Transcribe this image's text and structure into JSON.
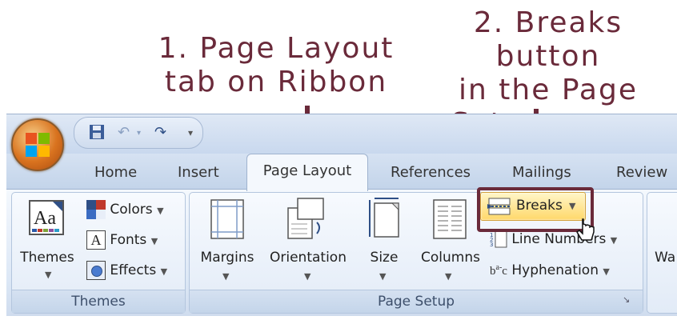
{
  "annotations": {
    "label1": "1. Page Layout tab on Ribbon",
    "label1_line1": "1. Page Layout",
    "label1_line2": "tab on Ribbon",
    "label2_line1": "2. Breaks button",
    "label2_line2": "in the Page",
    "label2_line3": "Setup group"
  },
  "tabs": [
    "Home",
    "Insert",
    "Page Layout",
    "References",
    "Mailings",
    "Review"
  ],
  "tab_labels": {
    "home": "Home",
    "insert": "Insert",
    "page_layout": "Page Layout",
    "references": "References",
    "mailings": "Mailings",
    "review": "Review"
  },
  "themes_group": {
    "themes_label": "Themes",
    "colors_label": "Colors",
    "fonts_label": "Fonts",
    "effects_label": "Effects",
    "group_label": "Themes"
  },
  "page_setup_group": {
    "margins_label": "Margins",
    "orientation_label": "Orientation",
    "size_label": "Size",
    "columns_label": "Columns",
    "breaks_label": "Breaks",
    "line_numbers_label": "Line Numbers",
    "hyphenation_label": "Hyphenation",
    "group_label": "Page Setup"
  },
  "next_group_partial": "Wa",
  "colors": {
    "annotation": "#6a2a3a",
    "breaks_highlight": "#ffd86a"
  }
}
